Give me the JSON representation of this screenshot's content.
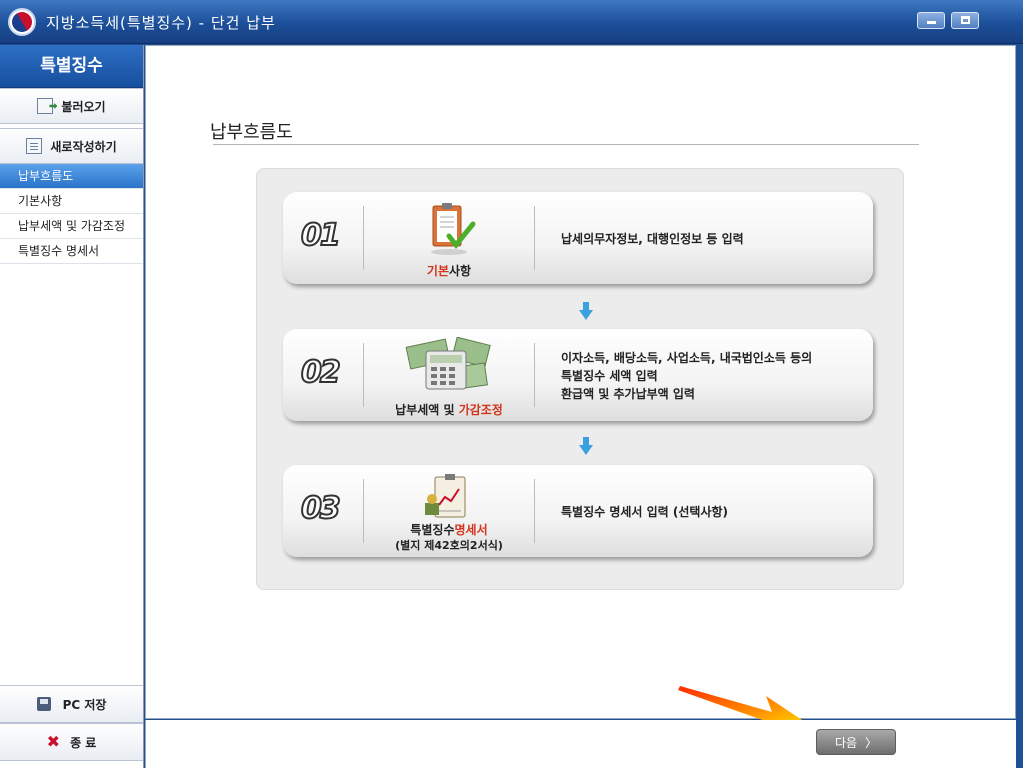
{
  "window": {
    "title": "지방소득세(특별징수) - 단건 납부"
  },
  "sidebar": {
    "header": "특별징수",
    "load_button": "불러오기",
    "new_button": "새로작성하기",
    "menu": [
      {
        "label": "납부흐름도",
        "active": true
      },
      {
        "label": "기본사항",
        "active": false
      },
      {
        "label": "납부세액 및 가감조정",
        "active": false
      },
      {
        "label": "특별징수 명세서",
        "active": false
      }
    ],
    "save_button": "PC 저장",
    "exit_button": "종 료"
  },
  "main": {
    "title": "납부흐름도",
    "steps": [
      {
        "number": "01",
        "label_highlight": "기본",
        "label_rest": "사항",
        "description": [
          "납세의무자정보, 대행인정보 등 입력"
        ]
      },
      {
        "number": "02",
        "label_prefix": "납부세액 및 ",
        "label_highlight": "가감조정",
        "description": [
          "이자소득, 배당소득, 사업소득, 내국법인소득 등의",
          "특별징수 세액 입력",
          "환급액 및 추가납부액 입력"
        ]
      },
      {
        "number": "03",
        "label_prefix": "특별징수",
        "label_highlight": "명세서",
        "label_sub": "(별지 제42호의2서식)",
        "description": [
          "특별징수 명세서 입력 (선택사항)"
        ]
      }
    ]
  },
  "footer": {
    "next_button": "다음"
  },
  "colors": {
    "titlebar": "#1c4f99",
    "accent_red": "#d4331c",
    "flow_arrow": "#3aa0e0",
    "active_menu": "#2a73c9"
  }
}
